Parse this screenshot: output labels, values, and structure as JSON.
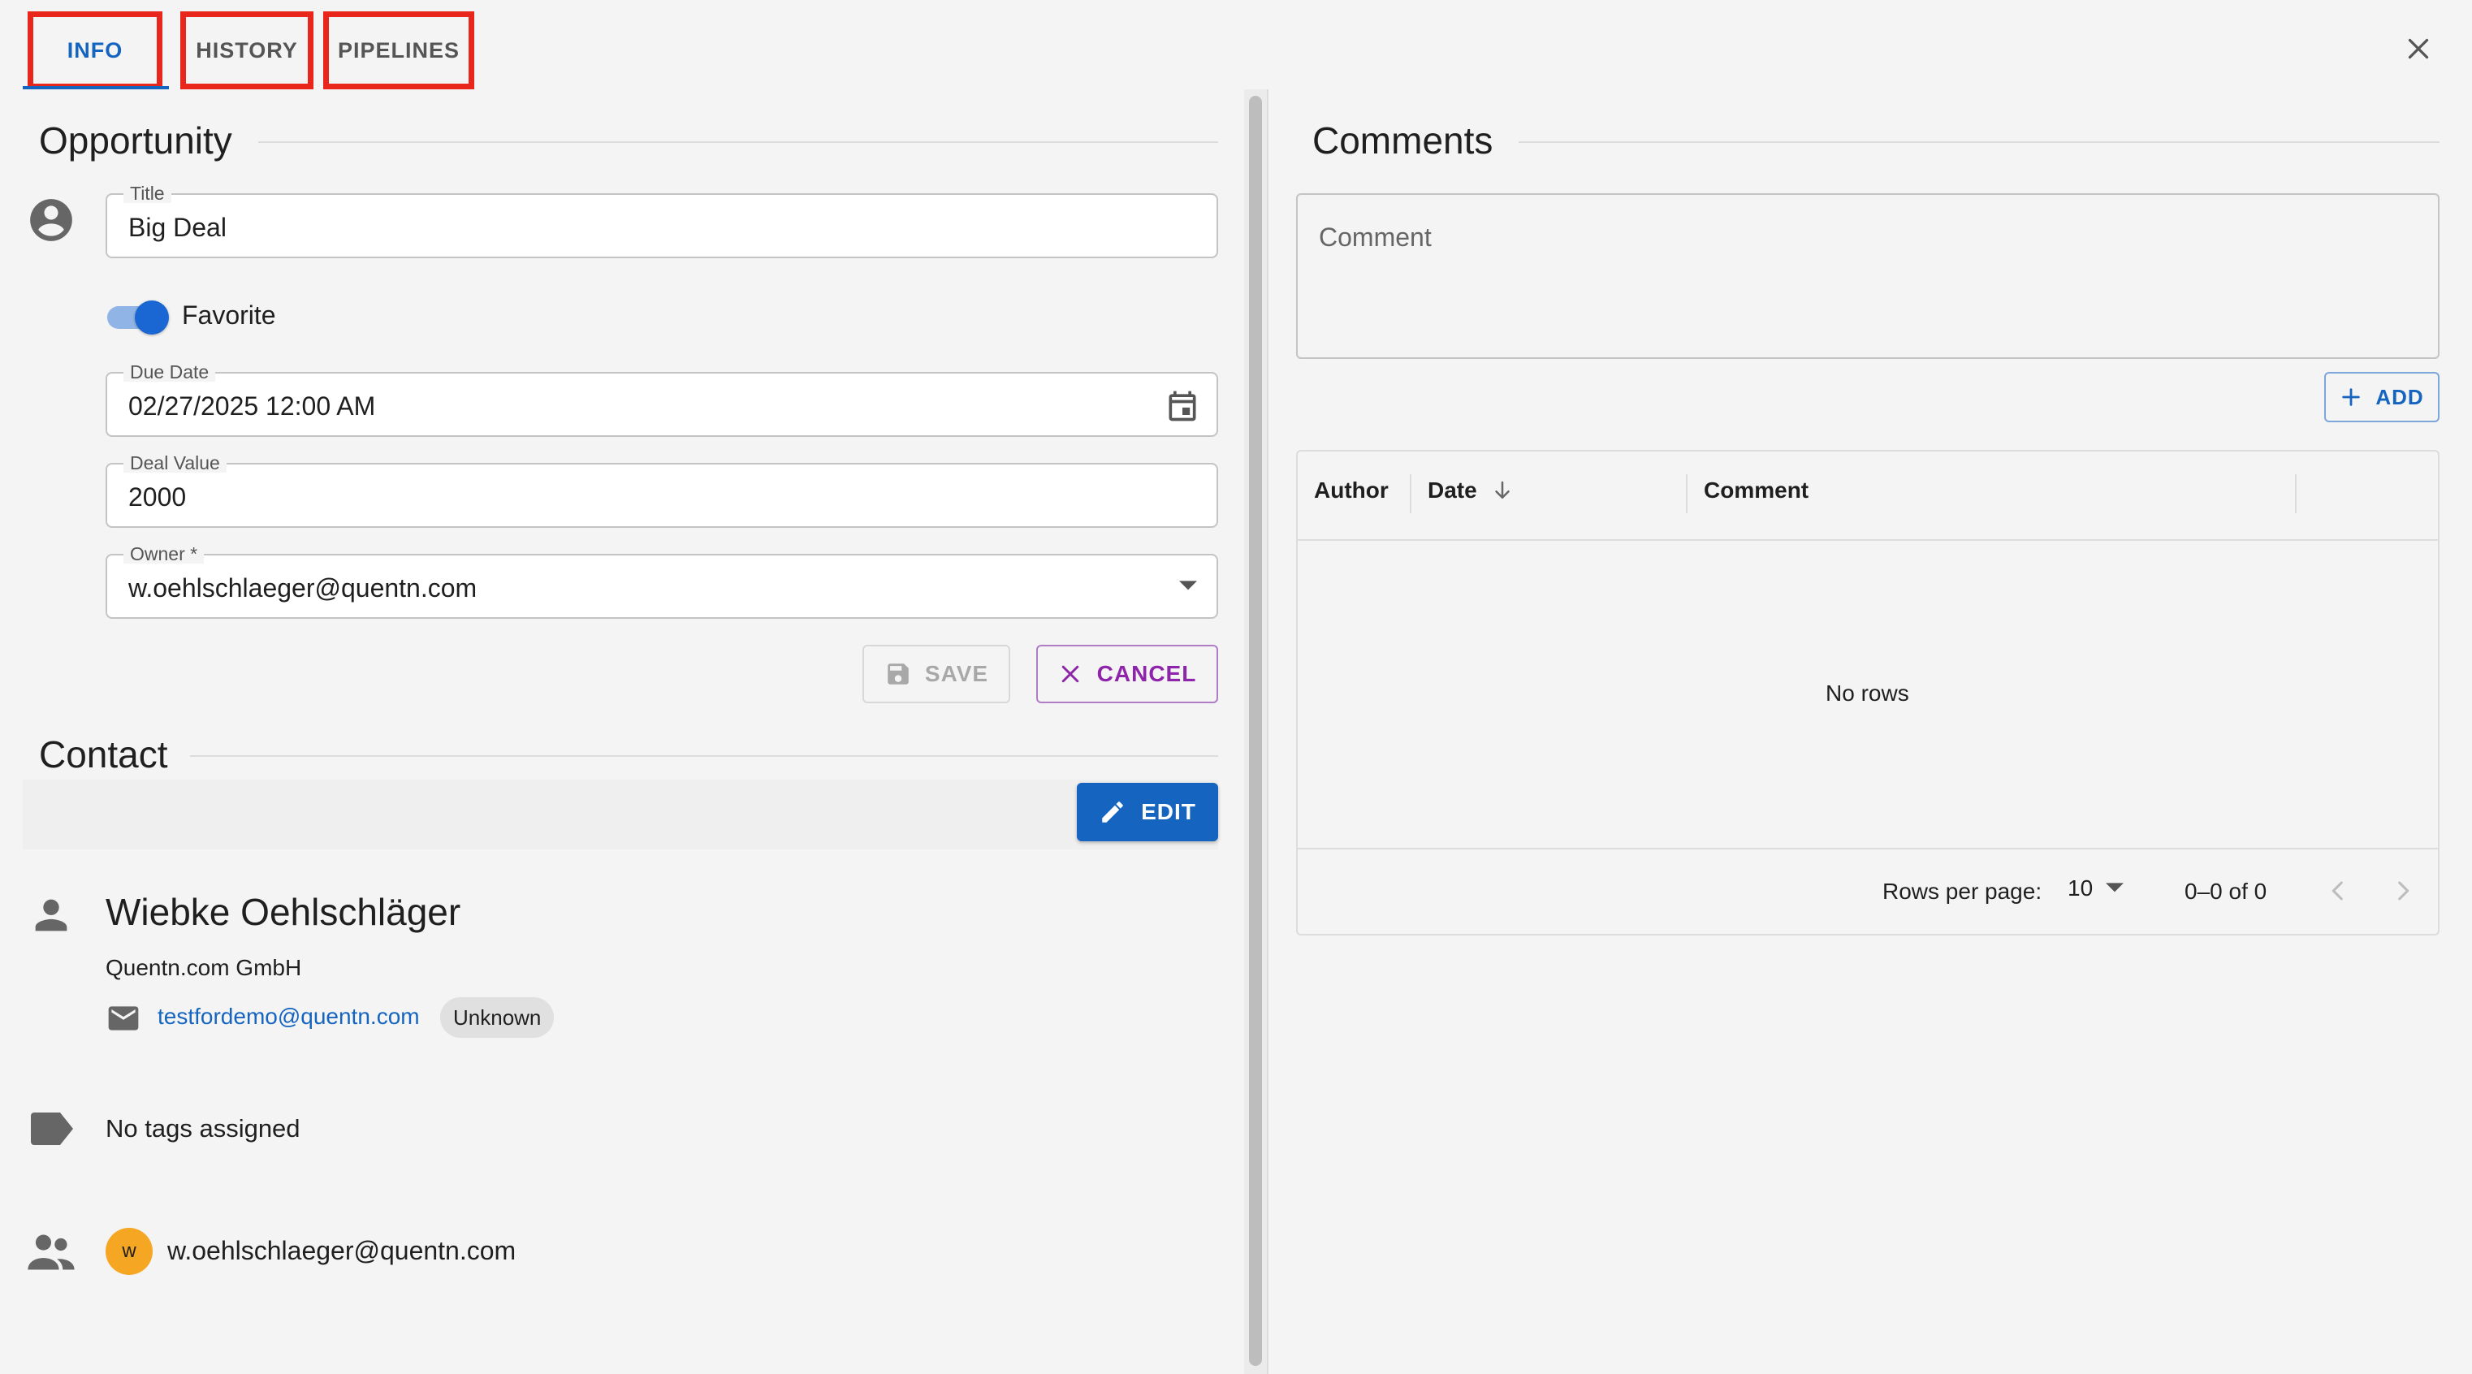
{
  "tabs": [
    {
      "label": "INFO",
      "active": true
    },
    {
      "label": "HISTORY",
      "active": false
    },
    {
      "label": "PIPELINES",
      "active": false
    }
  ],
  "opportunity": {
    "section_title": "Opportunity",
    "title_label": "Title",
    "title_value": "Big Deal",
    "favorite_label": "Favorite",
    "favorite_on": true,
    "due_date_label": "Due Date",
    "due_date_value": "02/27/2025 12:00 AM",
    "deal_value_label": "Deal Value",
    "deal_value_value": "2000",
    "owner_label": "Owner *",
    "owner_value": "w.oehlschlaeger@quentn.com",
    "save_label": "SAVE",
    "cancel_label": "CANCEL"
  },
  "contact": {
    "section_title": "Contact",
    "edit_label": "EDIT",
    "name": "Wiebke Oehlschläger",
    "company": "Quentn.com GmbH",
    "email": "testfordemo@quentn.com",
    "email_status": "Unknown",
    "tags_text": "No tags assigned",
    "member_initial": "w",
    "member_email": "w.oehlschlaeger@quentn.com"
  },
  "comments": {
    "section_title": "Comments",
    "placeholder": "Comment",
    "add_label": "ADD",
    "columns": [
      "Author",
      "Date",
      "Comment"
    ],
    "empty_text": "No rows",
    "rows_per_page_label": "Rows per page:",
    "rows_per_page_value": "10",
    "pagination_text": "0–0 of 0"
  },
  "colors": {
    "primary": "#1565c0",
    "cancel_purple": "#8e24aa",
    "highlight_red": "#e8261b",
    "avatar_orange": "#f5a623"
  }
}
